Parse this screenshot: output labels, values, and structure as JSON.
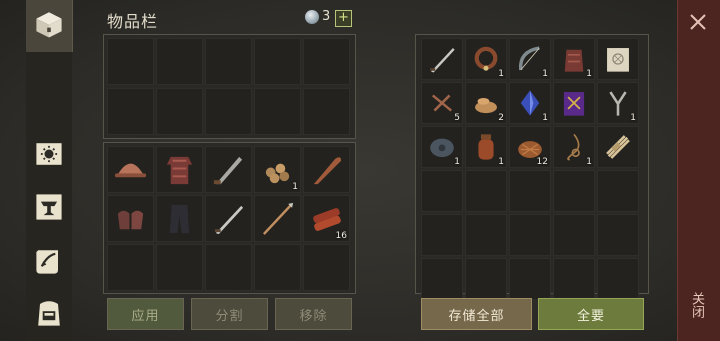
{
  "header": {
    "title": "物品栏",
    "gem_count": "3",
    "plus_label": "+"
  },
  "left_nav": [
    "chest-icon",
    "sun-icon",
    "anvil-icon",
    "scroll-icon",
    "backpack-icon"
  ],
  "player_inventory": {
    "top_rows": 2,
    "bottom_items": [
      {
        "icon": "helmet-icon",
        "count": ""
      },
      {
        "icon": "chainmail-icon",
        "count": ""
      },
      {
        "icon": "machete-icon",
        "count": ""
      },
      {
        "icon": "grain-pile-icon",
        "count": "1"
      },
      {
        "icon": "club-icon",
        "count": ""
      },
      {
        "icon": "gloves-icon",
        "count": ""
      },
      {
        "icon": "pants-icon",
        "count": ""
      },
      {
        "icon": "sword-icon",
        "count": ""
      },
      {
        "icon": "spear-icon",
        "count": ""
      },
      {
        "icon": "meat-icon",
        "count": "16"
      }
    ]
  },
  "storage_items": [
    {
      "icon": "sword-icon",
      "count": ""
    },
    {
      "icon": "collar-icon",
      "count": "1"
    },
    {
      "icon": "bow-icon",
      "count": "1"
    },
    {
      "icon": "armor-icon",
      "count": "1"
    },
    {
      "icon": "map-icon",
      "count": ""
    },
    {
      "icon": "nails-icon",
      "count": "5"
    },
    {
      "icon": "wood-chips-icon",
      "count": "2"
    },
    {
      "icon": "crystal-icon",
      "count": "1"
    },
    {
      "icon": "spellbook-icon",
      "count": ""
    },
    {
      "icon": "slingshot-icon",
      "count": "1"
    },
    {
      "icon": "cloth-roll-icon",
      "count": "1"
    },
    {
      "icon": "flask-icon",
      "count": "1"
    },
    {
      "icon": "basket-icon",
      "count": "12"
    },
    {
      "icon": "rope-icon",
      "count": "1"
    },
    {
      "icon": "straw-bundle-icon",
      "count": ""
    }
  ],
  "buttons": {
    "apply": "应用",
    "split": "分割",
    "remove": "移除",
    "store_all": "存储全部",
    "take_all": "全要"
  },
  "close_label": "关闭"
}
